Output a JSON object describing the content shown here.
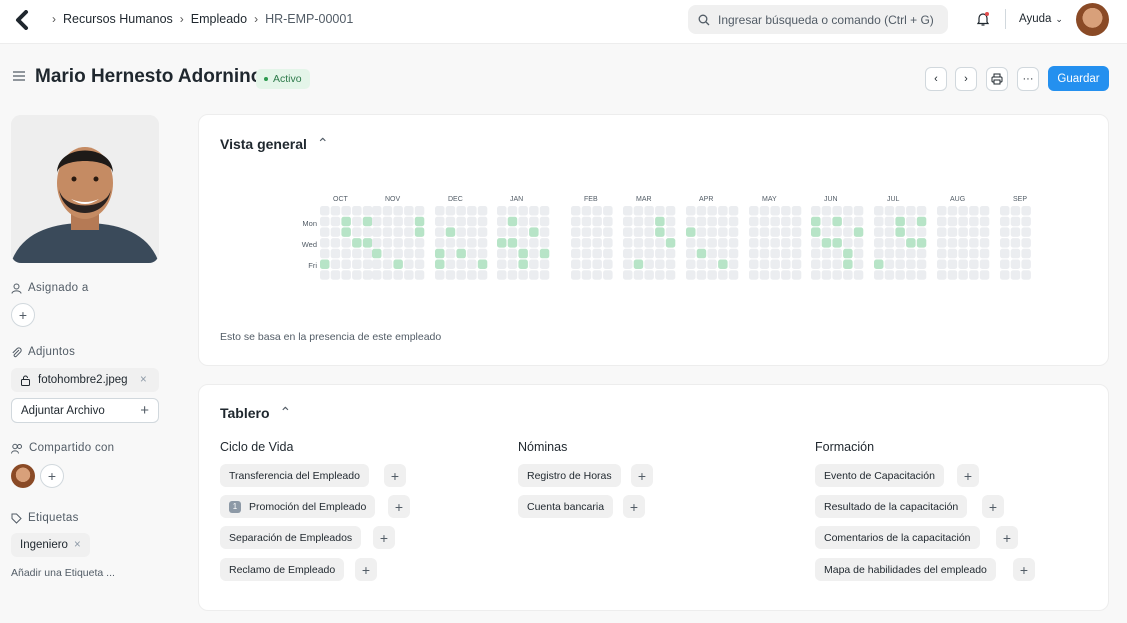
{
  "breadcrumb": {
    "items": [
      "Recursos Humanos",
      "Empleado",
      "HR-EMP-00001"
    ]
  },
  "search": {
    "placeholder": "Ingresar búsqueda o comando (Ctrl + G)"
  },
  "nav": {
    "help_label": "Ayuda"
  },
  "page": {
    "title": "Mario Hernesto Adornino",
    "status": "Activo",
    "save_label": "Guardar"
  },
  "sidebar": {
    "assigned_label": "Asignado a",
    "attachments_label": "Adjuntos",
    "attachment_file": "fotohombre2.jpeg",
    "attach_file_label": "Adjuntar Archivo",
    "shared_label": "Compartido con",
    "tags_label": "Etiquetas",
    "tag": "Ingeniero",
    "add_tag_label": "Añadir una Etiqueta ..."
  },
  "overview": {
    "title": "Vista general",
    "months": [
      "OCT",
      "NOV",
      "DEC",
      "JAN",
      "FEB",
      "MAR",
      "APR",
      "MAY",
      "JUN",
      "JUL",
      "AUG",
      "SEP"
    ],
    "day_labels": [
      "Mon",
      "Wed",
      "Fri"
    ],
    "note": "Esto se basa en la presencia de este empleado"
  },
  "dashboard": {
    "title": "Tablero",
    "columns": [
      {
        "heading": "Ciclo de Vida",
        "items": [
          "Transferencia del Empleado",
          "Promoción del Empleado",
          "Separación de Empleados",
          "Reclamo de Empleado"
        ]
      },
      {
        "heading": "Nóminas",
        "items": [
          "Registro de Horas",
          "Cuenta bancaria"
        ]
      },
      {
        "heading": "Formación",
        "items": [
          "Evento de Capacitación",
          "Resultado de la capacitación",
          "Comentarios de la capacitación",
          "Mapa de habilidades del empleado"
        ]
      }
    ],
    "promo_count": "1"
  },
  "colors": {
    "accent": "#2490ef",
    "heat_on": "#b7e4c7",
    "heat_off": "#ebedf0"
  }
}
